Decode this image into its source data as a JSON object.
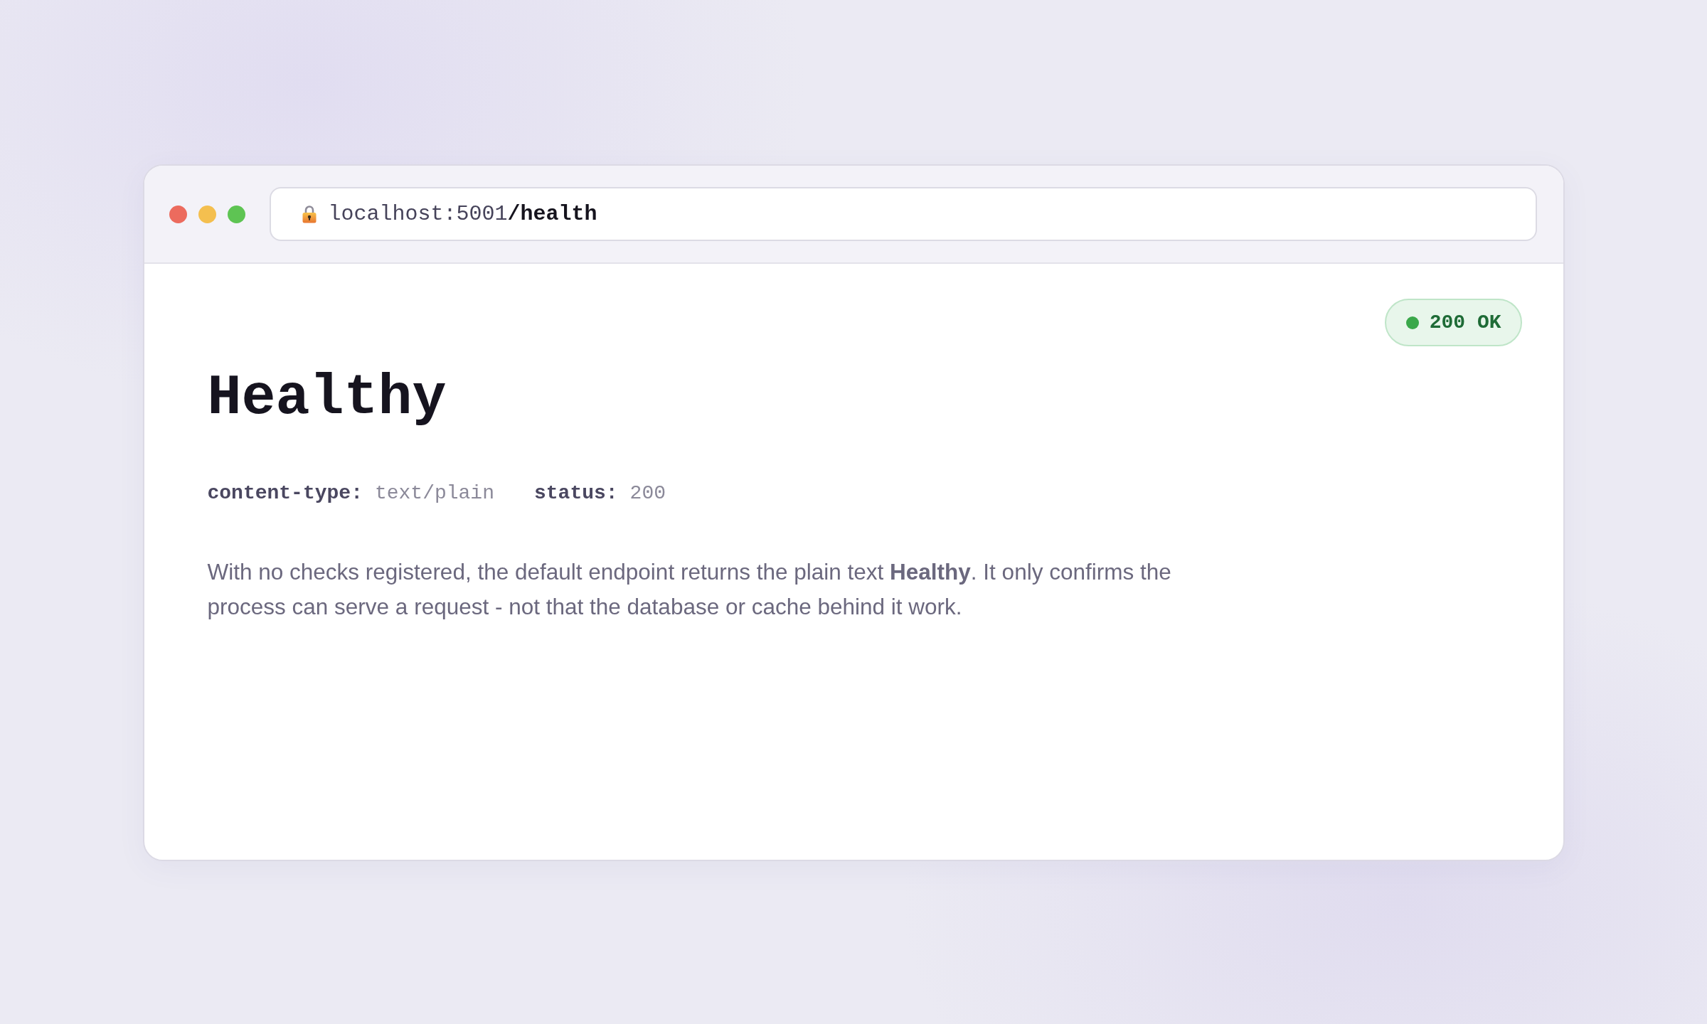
{
  "window": {
    "controls": [
      {
        "color": "#ec6b5e"
      },
      {
        "color": "#f4bf4f"
      },
      {
        "color": "#5ec453"
      }
    ],
    "address_bar": {
      "host": "localhost:5001",
      "path": "/health"
    }
  },
  "page": {
    "status_badge": {
      "label": "200 OK"
    },
    "heading": "Healthy",
    "headers": [
      {
        "name": "content-type:",
        "value": "text/plain"
      },
      {
        "name": "status:",
        "value": "200"
      }
    ],
    "description": "With no checks registered, the default endpoint returns the plain text **Healthy**. It only confirms the process can serve a request - not that the database or cache behind it work."
  }
}
